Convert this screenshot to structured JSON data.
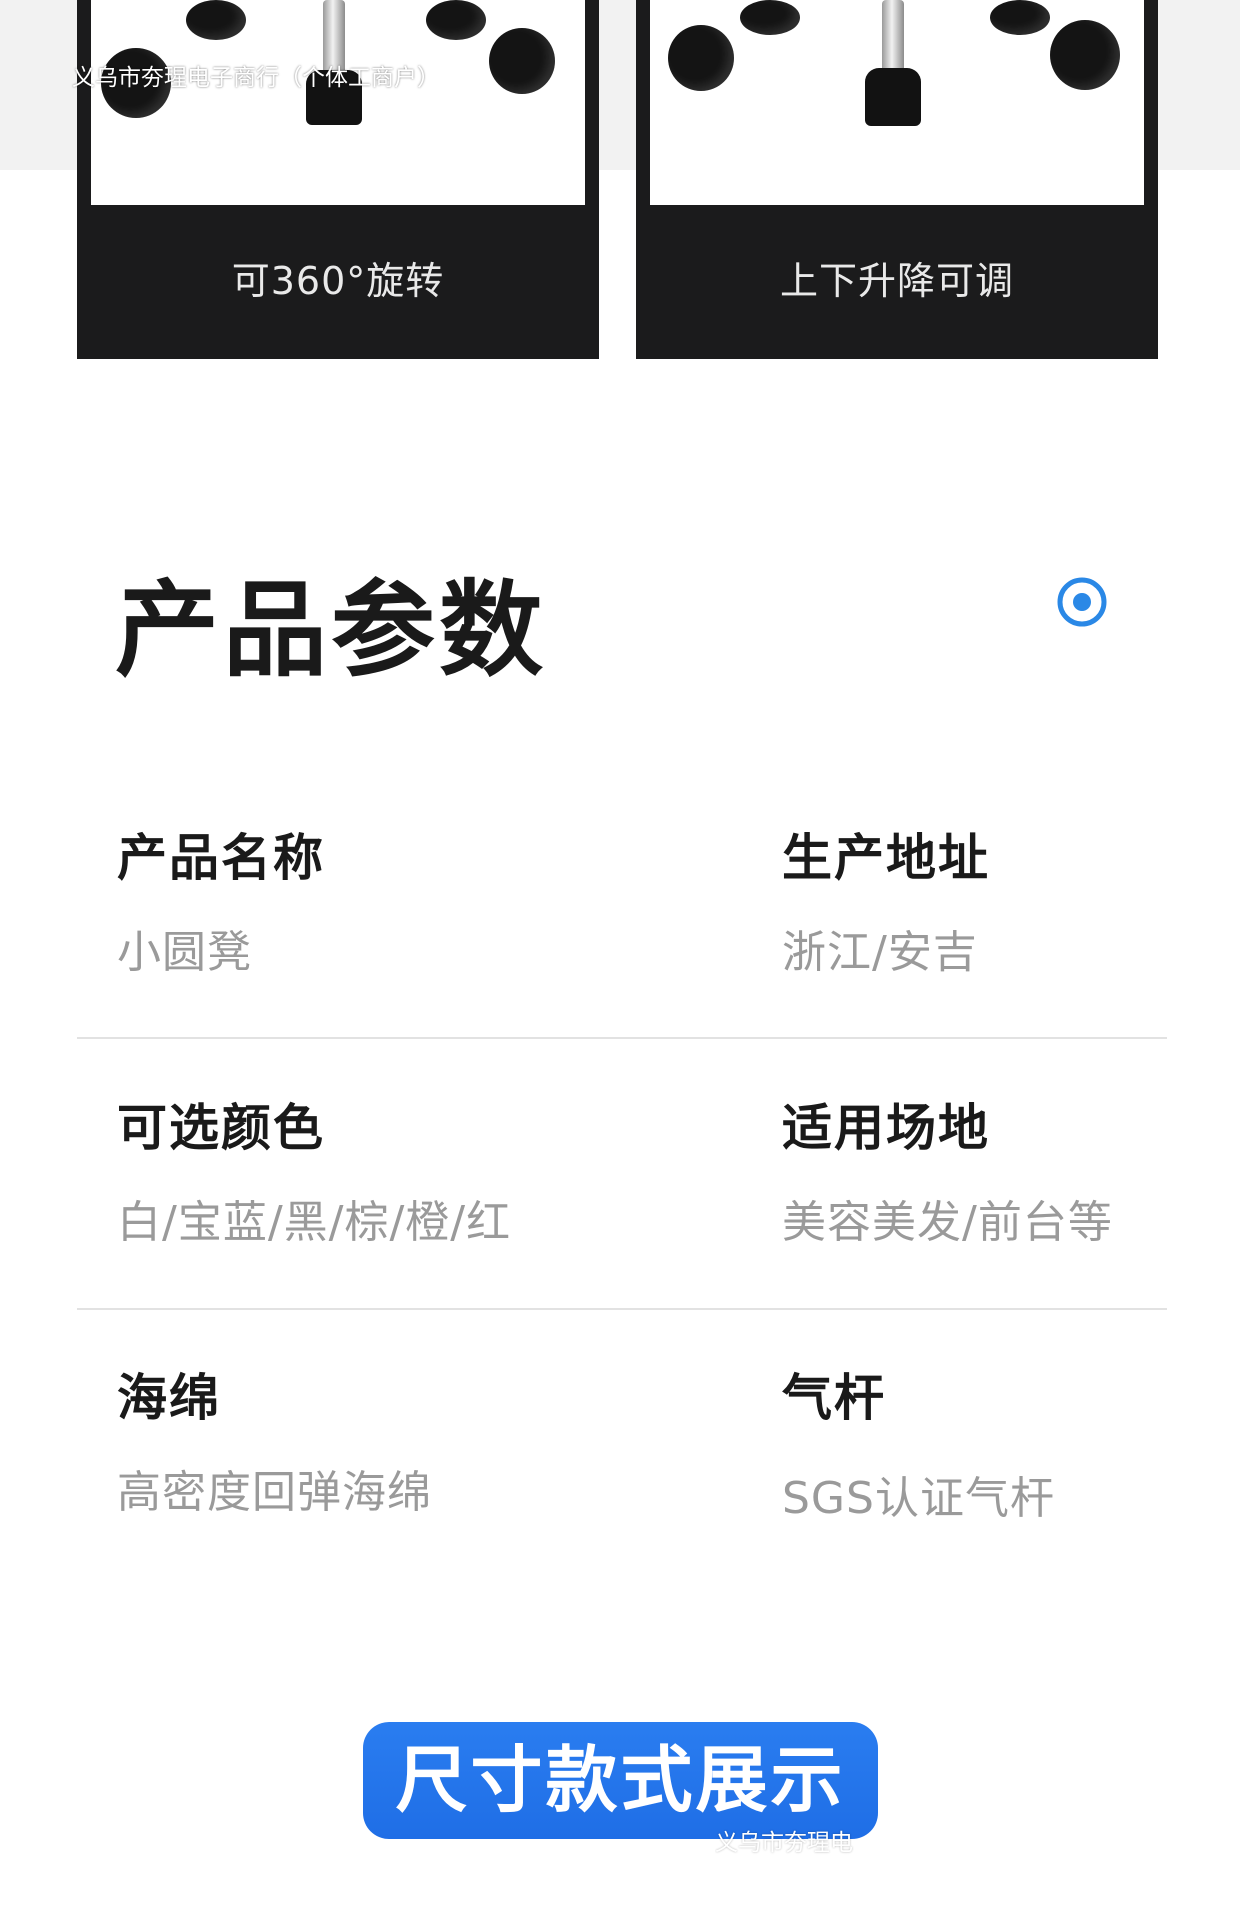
{
  "watermark": {
    "shop_top": "义乌市夯瑆电子商行（个体工商户）",
    "shop_bottom": "义乌市夯瑆电"
  },
  "features": [
    {
      "caption": "可360°旋转"
    },
    {
      "caption": "上下升降可调"
    }
  ],
  "section": {
    "title": "产品参数",
    "icon": "target-icon"
  },
  "params": [
    {
      "label": "产品名称",
      "value": "小圆凳"
    },
    {
      "label": "生产地址",
      "value": "浙江/安吉"
    },
    {
      "label": "可选颜色",
      "value": "白/宝蓝/黑/棕/橙/红"
    },
    {
      "label": "适用场地",
      "value": "美容美发/前台等"
    },
    {
      "label": "海绵",
      "value": "高密度回弹海绵"
    },
    {
      "label": "气杆",
      "value": "SGS认证气杆"
    }
  ],
  "cta": {
    "label": "尺寸款式展示"
  },
  "colors": {
    "accent": "#1f6ee6",
    "card_bg": "#1b1b1c",
    "label_text": "#1a1a1a",
    "value_text": "#9a9a9a"
  }
}
